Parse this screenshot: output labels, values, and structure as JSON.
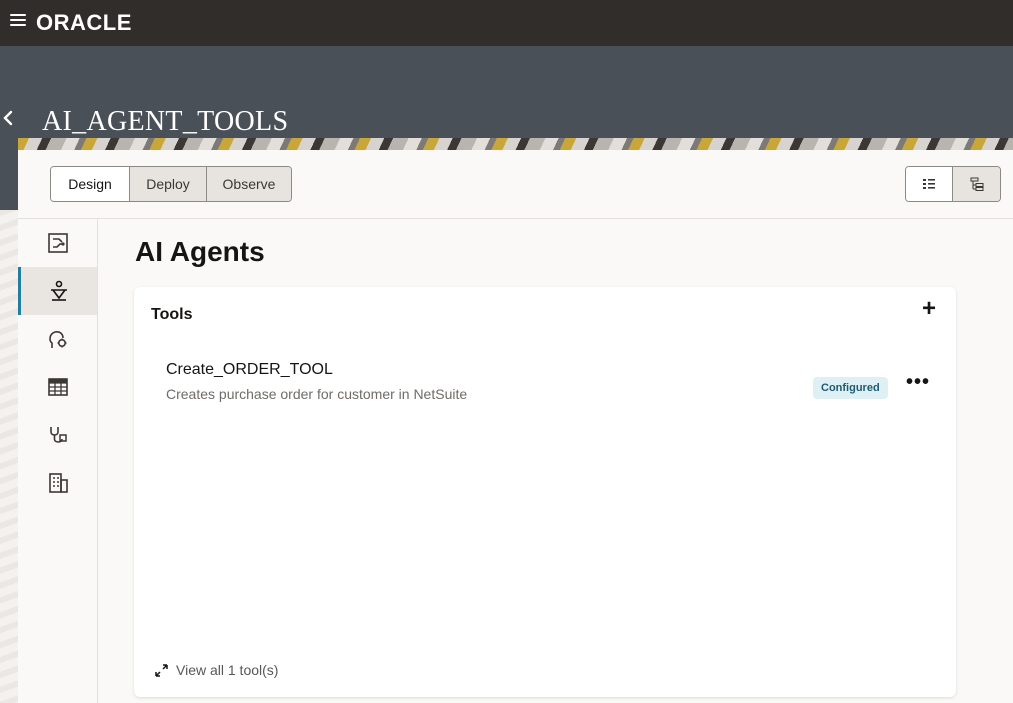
{
  "brand": {
    "logo_text": "ORACLE"
  },
  "header": {
    "title": "AI_AGENT_TOOLS",
    "back_icon": "chevron-left-icon"
  },
  "tabs": [
    {
      "label": "Design",
      "selected": true
    },
    {
      "label": "Deploy",
      "selected": false
    },
    {
      "label": "Observe",
      "selected": false
    }
  ],
  "view_toggle": {
    "left_icon": "list-view-icon",
    "right_icon": "tree-view-icon"
  },
  "sidenav": {
    "items": [
      {
        "icon": "integration-flow-icon",
        "active": false
      },
      {
        "icon": "ai-agent-icon",
        "active": true
      },
      {
        "icon": "agent-settings-icon",
        "active": false
      },
      {
        "icon": "table-icon",
        "active": false
      },
      {
        "icon": "stethoscope-icon",
        "active": false
      },
      {
        "icon": "building-icon",
        "active": false
      }
    ]
  },
  "main": {
    "title": "AI Agents",
    "tools": {
      "heading": "Tools",
      "add_label": "+",
      "items": [
        {
          "name": "Create_ORDER_TOOL",
          "description": "Creates purchase order for customer in NetSuite",
          "status": "Configured"
        }
      ],
      "more_label": "•••",
      "view_all_label": "View all 1 tool(s)"
    }
  },
  "colors": {
    "topbar": "#312d2a",
    "header": "#4a5058",
    "accent": "#227e9e",
    "badge_bg": "#dff0f5",
    "badge_text": "#1e5a73"
  }
}
